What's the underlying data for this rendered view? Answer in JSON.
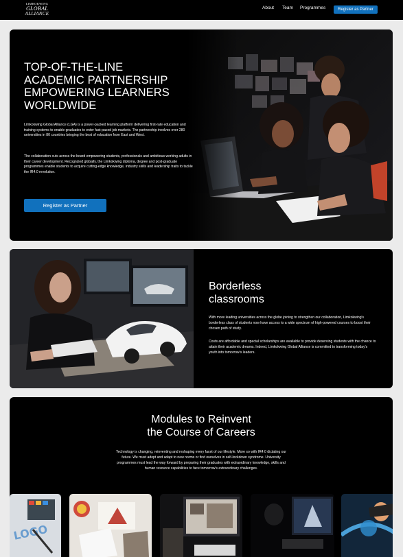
{
  "header": {
    "logo": {
      "line1": "LIMKOKWING",
      "line2": "GLOBAL",
      "line3": "ALLIANCE"
    },
    "nav": [
      {
        "label": "About"
      },
      {
        "label": "Team"
      },
      {
        "label": "Programmes"
      }
    ],
    "cta_label": "Register as Partner"
  },
  "hero": {
    "title_lines": [
      "TOP-OF-THE-LINE",
      "ACADEMIC PARTNERSHIP",
      "EMPOWERING LEARNERS",
      "WORLDWIDE"
    ],
    "paragraph1": "Limkokwing Global Alliance (LGA) is a power-packed learning platform delivering first-rate education and training systems to enable graduates to enter fast-paced job markets. The partnership involves over 280 universities in 80 countries bringing the best of education from East and West.",
    "paragraph2": "The collaboration cuts across the board empowering students, professionals and ambitious working adults in their career development. Recognized globally, the Limkokwing diploma, degree and post-graduate programmes enable students to acquire cutting-edge knowledge, industry skills and leadership traits to tackle the IR4.0 revolution.",
    "button_label": "Register as Partner"
  },
  "borderless": {
    "title_lines": [
      "Borderless",
      "classrooms"
    ],
    "paragraph1": "With more leading universities across the globe joining to strengthen our collaboration, Limkokwing's borderless class of students now have access to a wide spectrum of high-powered courses to boost their chosen path of study.",
    "paragraph2": "Costs are affordable and special scholarships are available to provide deserving students with the chance to attain their academic dreams. Indeed, Limkokwing Global Alliance is committed to transforming today's youth into tomorrow's leaders."
  },
  "modules": {
    "title_lines": [
      "Modules to Reinvent",
      "the Course of Careers"
    ],
    "paragraph": "Technology is changing, reinventing and reshaping every facet of our lifestyle. More so with IR4.0 dictating our future. We must adopt and adapt to new norms or find ourselves in self-lockdown syndrome. University programmes must lead the way forward by preparing their graduates with extraordinary knowledge, skills and human resource capabilities to face tomorrow's extraordinary challenges."
  },
  "colors": {
    "accent": "#1171bd",
    "background": "#ebebeb",
    "card": "#000000"
  }
}
